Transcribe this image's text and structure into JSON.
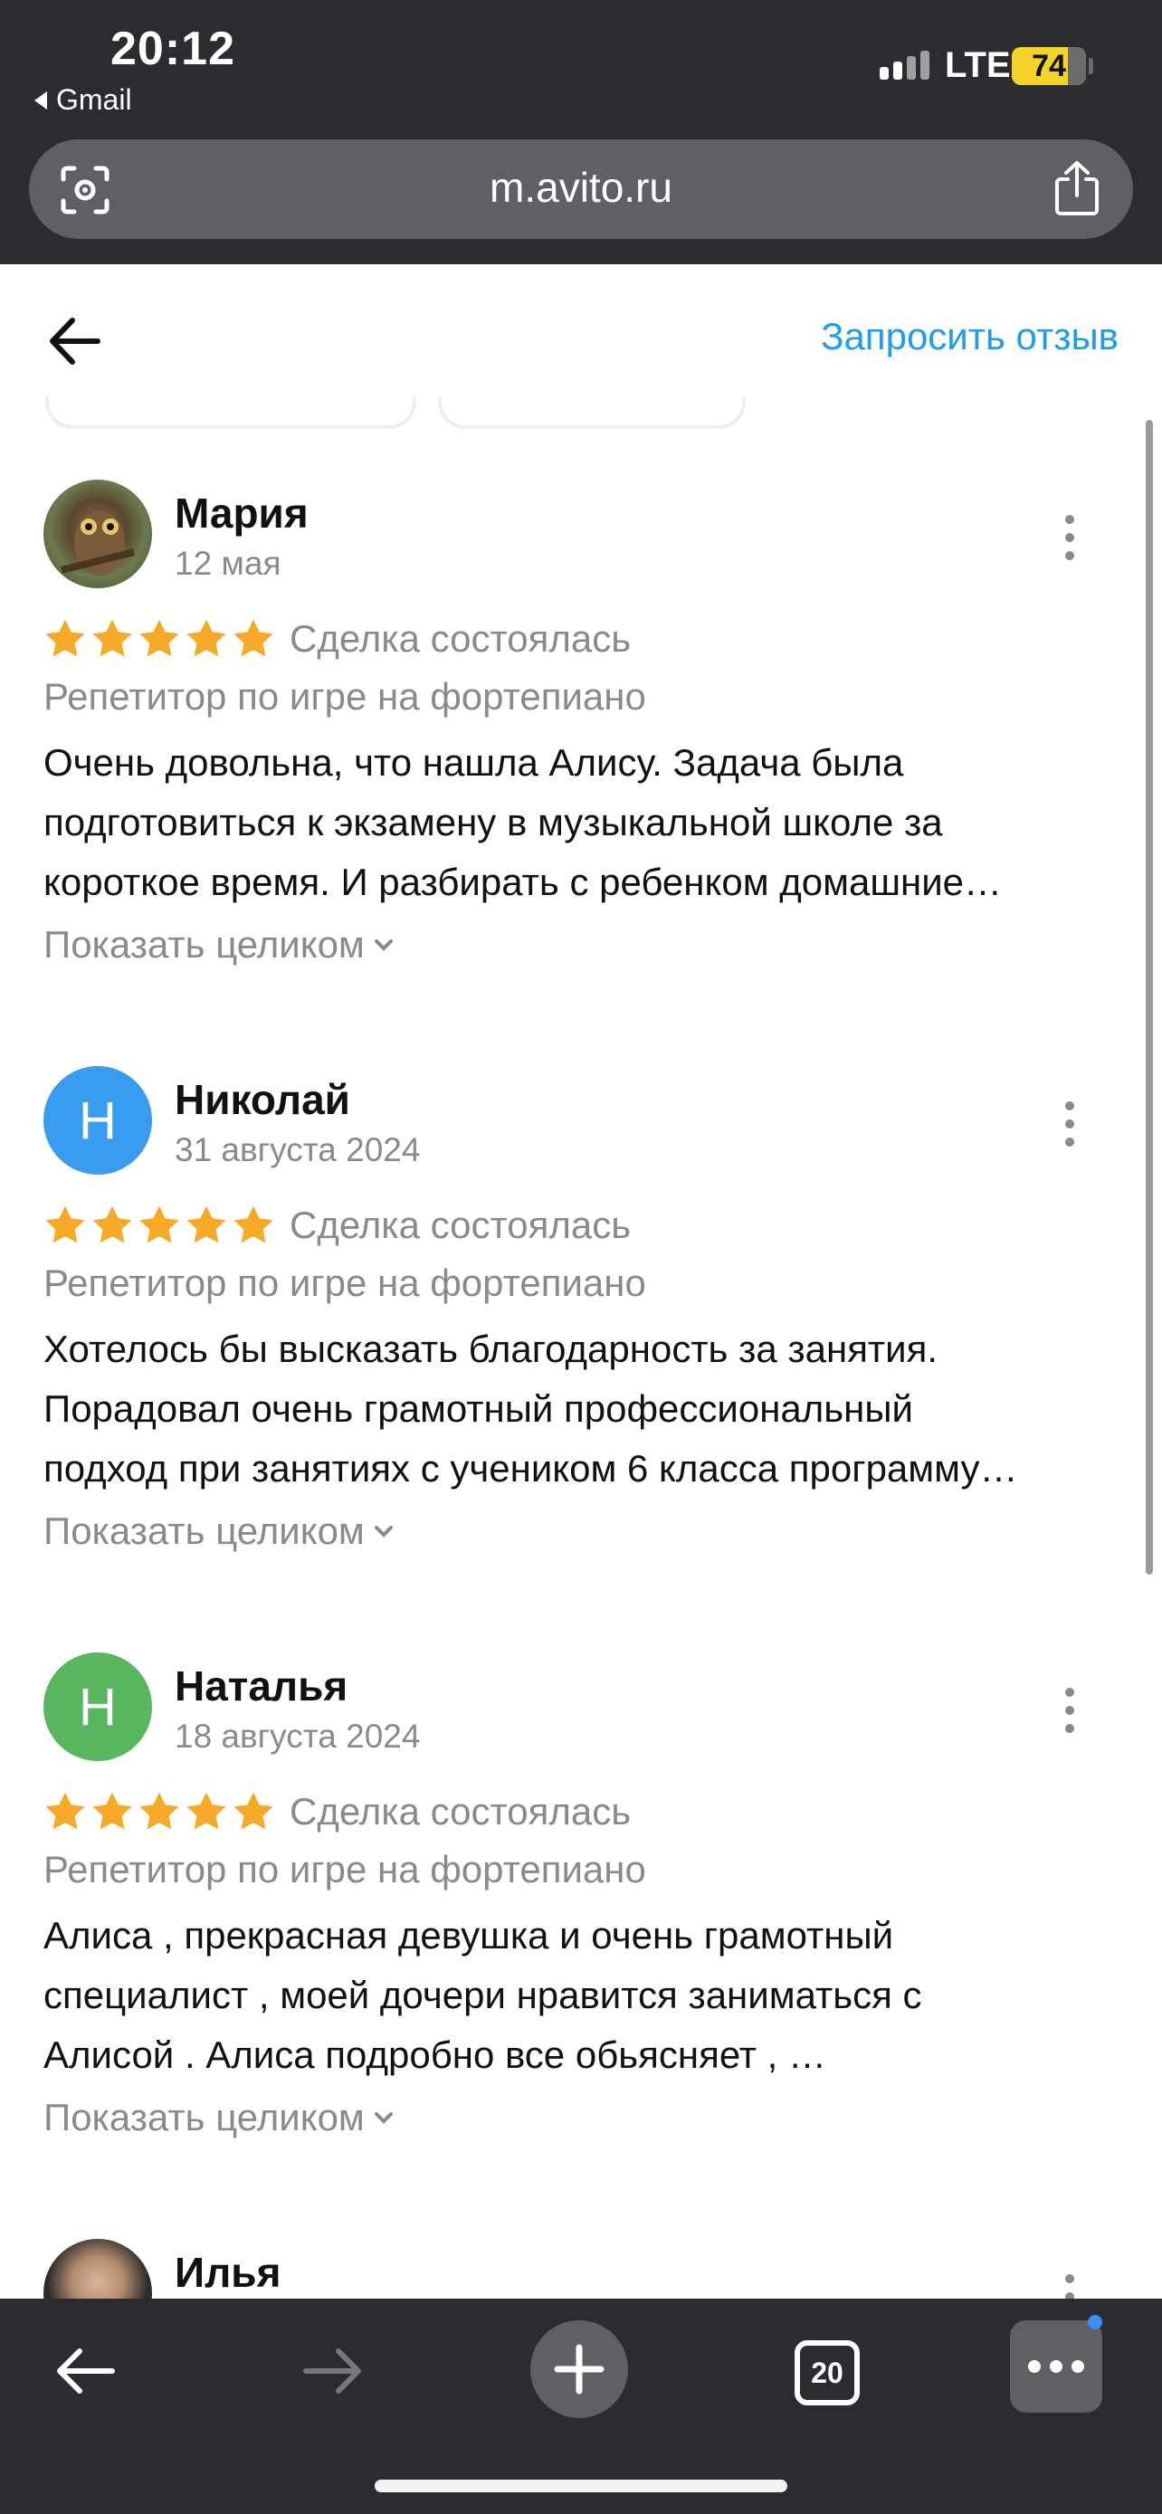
{
  "status_bar": {
    "time": "20:12",
    "back_app": "Gmail",
    "network": "LTE",
    "battery": "74"
  },
  "browser": {
    "url": "m.avito.ru",
    "tab_count": "20",
    "icons": {
      "lens": "lens-icon",
      "share": "share-icon",
      "back": "back-arrow-icon",
      "forward": "forward-arrow-icon",
      "new_tab": "plus-icon",
      "menu": "more-horizontal-icon"
    }
  },
  "header": {
    "request_review": "Запросить отзыв"
  },
  "colors": {
    "star": "#f7a928",
    "link": "#1e9cf0",
    "avatar_nikolay": "#3a9cf0",
    "avatar_natalya": "#58b65f",
    "chrome": "#2b2c2f"
  },
  "reviews": [
    {
      "author": "Мария",
      "date": "12 мая",
      "rating": 5,
      "status": "Сделка состоялась",
      "service": "Репетитор по игре на фортепиано",
      "text_lines": [
        "Очень довольна, что нашла Алису. Задача была",
        "подготовиться к экзамену в музыкальной школе за",
        "короткое время. И разбирать с ребенком домашние…"
      ],
      "expand": "Показать целиком",
      "avatar_initial": ""
    },
    {
      "author": "Николай",
      "date": "31 августа 2024",
      "rating": 5,
      "status": "Сделка состоялась",
      "service": "Репетитор по игре на фортепиано",
      "text_lines": [
        "Хотелось бы высказать благодарность за занятия.",
        "Порадовал очень грамотный профессиональный",
        "подход при занятиях с учеником 6 класса программу…"
      ],
      "expand": "Показать целиком",
      "avatar_initial": "Н"
    },
    {
      "author": "Наталья",
      "date": "18 августа 2024",
      "rating": 5,
      "status": "Сделка состоялась",
      "service": "Репетитор по игре на фортепиано",
      "text_lines": [
        "Алиса , прекрасная девушка и очень грамотный",
        "специалист , моей дочери нравится заниматься с",
        "Алисой . Алиса подробно все обьясняет , …"
      ],
      "expand": "Показать целиком",
      "avatar_initial": "Н"
    },
    {
      "author": "Илья"
    }
  ]
}
